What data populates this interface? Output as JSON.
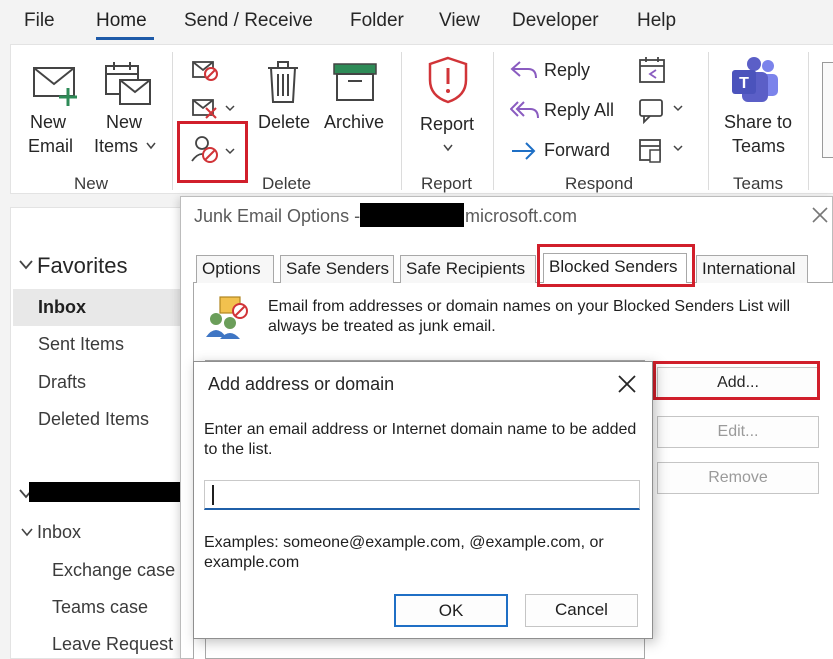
{
  "menu": {
    "file": "File",
    "home": "Home",
    "send_receive": "Send / Receive",
    "folder": "Folder",
    "view": "View",
    "developer": "Developer",
    "help": "Help"
  },
  "ribbon": {
    "new_group": {
      "label": "New",
      "new_email": [
        "New",
        "Email"
      ],
      "new_items": [
        "New",
        "Items"
      ]
    },
    "delete_group": {
      "label": "Delete",
      "delete": "Delete",
      "archive": "Archive"
    },
    "report_group": {
      "label": "Report",
      "report": "Report"
    },
    "respond_group": {
      "label": "Respond",
      "reply": "Reply",
      "reply_all": "Reply All",
      "forward": "Forward"
    },
    "teams_group": {
      "label": "Teams",
      "share_to_teams": [
        "Share to",
        "Teams"
      ]
    }
  },
  "folders": {
    "favorites_header": "Favorites",
    "favorites": [
      "Inbox",
      "Sent Items",
      "Drafts",
      "Deleted Items"
    ],
    "account_inbox": "Inbox",
    "subfolders": [
      "Exchange case",
      "Teams case",
      "Leave Request"
    ]
  },
  "junk_dialog": {
    "title_prefix": "Junk Email Options -",
    "title_suffix": "microsoft.com",
    "tabs": [
      "Options",
      "Safe Senders",
      "Safe Recipients",
      "Blocked Senders",
      "International"
    ],
    "active_tab": "Blocked Senders",
    "info_text": "Email from addresses or domain names on your Blocked Senders List will always be treated as junk email.",
    "buttons": {
      "add": "Add...",
      "edit": "Edit...",
      "remove": "Remove"
    }
  },
  "add_dialog": {
    "title": "Add address or domain",
    "prompt": "Enter an email address or Internet domain name to be added to the list.",
    "input_value": "",
    "examples": "Examples: someone@example.com, @example.com, or example.com",
    "ok": "OK",
    "cancel": "Cancel"
  },
  "colors": {
    "accent": "#1e5aa8",
    "highlight_red": "#d11f2b",
    "report_red": "#d13438",
    "new_green": "#2e8b57",
    "teams_purple": "#5b5fc7"
  }
}
